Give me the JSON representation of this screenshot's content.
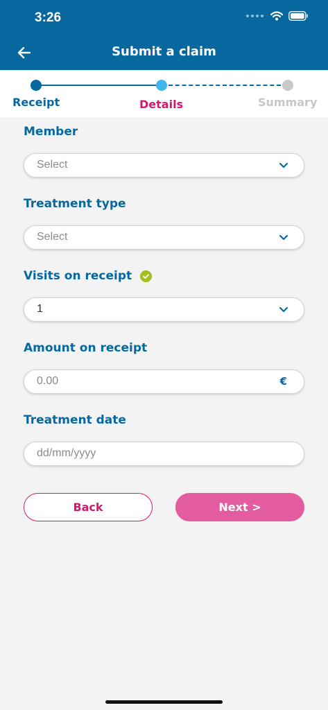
{
  "status_bar": {
    "time": "3:26"
  },
  "header": {
    "title": "Submit a claim",
    "back_icon": "arrow-left-icon"
  },
  "stepper": {
    "steps": [
      {
        "label": "Receipt",
        "state": "completed",
        "color": "#0768a0"
      },
      {
        "label": "Details",
        "state": "current",
        "color": "#d4186c"
      },
      {
        "label": "Summary",
        "state": "upcoming",
        "color": "#c6c6c6"
      }
    ]
  },
  "form": {
    "member": {
      "label": "Member",
      "placeholder": "Select"
    },
    "treatment_type": {
      "label": "Treatment type",
      "placeholder": "Select"
    },
    "visits": {
      "label": "Visits on receipt",
      "value": "1",
      "valid_icon": "check-circle-icon"
    },
    "amount": {
      "label": "Amount on receipt",
      "placeholder": "0.00",
      "currency_symbol": "€"
    },
    "treatment_date": {
      "label": "Treatment date",
      "placeholder": "dd/mm/yyyy"
    }
  },
  "buttons": {
    "back": "Back",
    "next": "Next >"
  },
  "colors": {
    "brand_blue": "#0768a0",
    "accent_pink": "#d4186c",
    "next_button": "#e35ca0",
    "progress_light_blue": "#3fb7ea",
    "valid_green": "#a5bd1d"
  }
}
